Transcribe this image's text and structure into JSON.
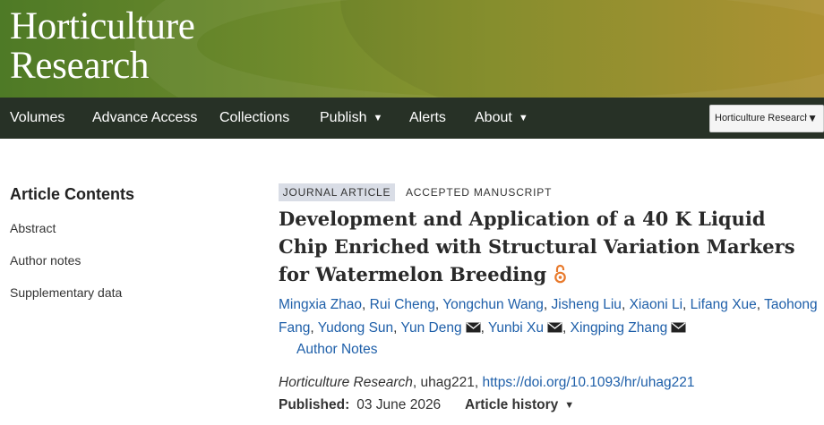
{
  "header": {
    "journal_title_line1": "Horticulture",
    "journal_title_line2": "Research",
    "banner_colors": [
      "#4e7a26",
      "#b79a36"
    ]
  },
  "nav": {
    "items": [
      {
        "label": "Volumes"
      },
      {
        "label": "Advance Access"
      },
      {
        "label": "Collections"
      },
      {
        "label": "Publish",
        "dropdown": true
      },
      {
        "label": "Alerts"
      },
      {
        "label": "About",
        "dropdown": true
      }
    ],
    "journal_select_value": "Horticulture Research",
    "background": "#273126"
  },
  "sidebar": {
    "title": "Article Contents",
    "items": [
      {
        "label": "Abstract"
      },
      {
        "label": "Author notes"
      },
      {
        "label": "Supplementary data"
      }
    ]
  },
  "article": {
    "type_badge": "JOURNAL ARTICLE",
    "status_badge": "ACCEPTED MANUSCRIPT",
    "title": "Development and Application of a 40 K Liquid Chip Enriched with Structural Variation Markers for Watermelon Breeding",
    "open_access_icon": "open-access-icon",
    "authors": [
      {
        "name": "Mingxia Zhao",
        "mail": false
      },
      {
        "name": "Rui Cheng",
        "mail": false
      },
      {
        "name": "Yongchun Wang",
        "mail": false
      },
      {
        "name": "Jisheng Liu",
        "mail": false
      },
      {
        "name": "Xiaoni Li",
        "mail": false
      },
      {
        "name": "Lifang Xue",
        "mail": false
      },
      {
        "name": "Taohong Fang",
        "mail": false
      },
      {
        "name": "Yudong Sun",
        "mail": false
      },
      {
        "name": "Yun Deng",
        "mail": true
      },
      {
        "name": "Yunbi Xu",
        "mail": true
      },
      {
        "name": "Xingping Zhang",
        "mail": true
      }
    ],
    "author_notes_label": "Author Notes",
    "citation": {
      "journal": "Horticulture Research",
      "article_id": ", uhag221, ",
      "doi": "https://doi.org/10.1093/hr/uhag221"
    },
    "published_label": "Published:",
    "published_date": "03 June 2026",
    "article_history_label": "Article history",
    "link_color": "#1e5fa9"
  }
}
